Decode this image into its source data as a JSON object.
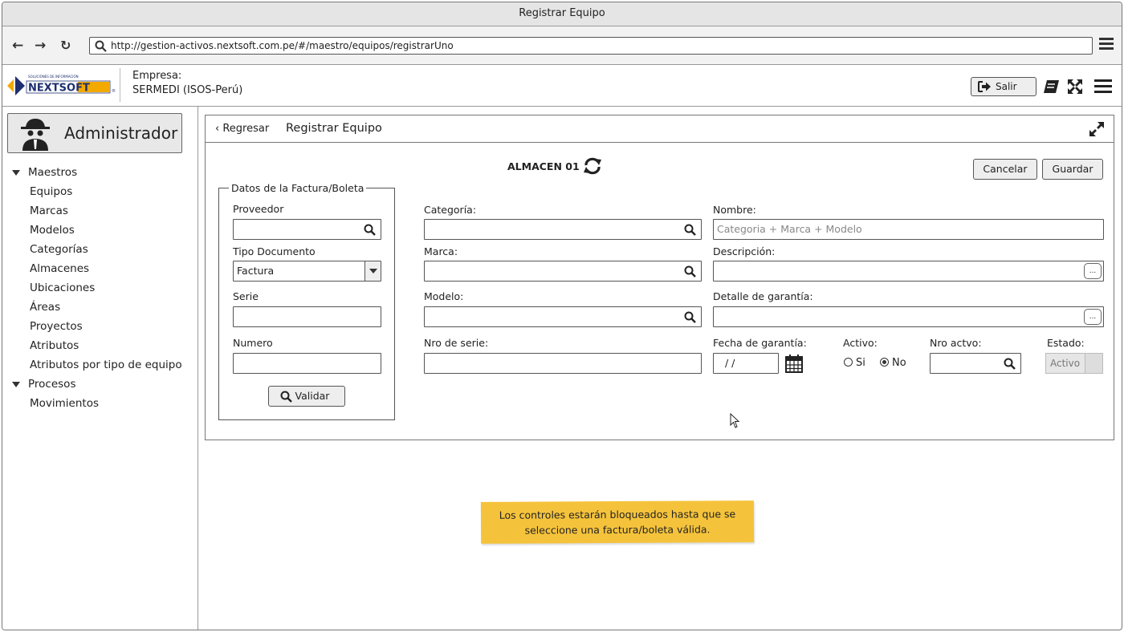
{
  "window": {
    "title": "Registrar Equipo"
  },
  "browser": {
    "url": "http://gestion-activos.nextsoft.com.pe/#/maestro/equipos/registrarUno"
  },
  "header": {
    "logo_text": "NEXTSOFT",
    "logo_tagline": "SOLUCIONES DE INFORMACIÓN",
    "empresa_label": "Empresa:",
    "empresa_value": "SERMEDI (ISOS-Perú)",
    "salir_label": "Salir"
  },
  "sidebar": {
    "user": "Administrador",
    "groups": [
      {
        "label": "Maestros",
        "items": [
          "Equipos",
          "Marcas",
          "Modelos",
          "Categorías",
          "Almacenes",
          "Ubicaciones",
          "Áreas",
          "Proyectos",
          "Atributos",
          "Atributos por tipo de equipo"
        ]
      },
      {
        "label": "Procesos",
        "items": [
          "Movimientos"
        ]
      }
    ]
  },
  "panel": {
    "back_label": "Regresar",
    "title": "Registrar Equipo",
    "almacen": "ALMACEN 01",
    "cancel_label": "Cancelar",
    "save_label": "Guardar",
    "factura": {
      "legend": "Datos de la Factura/Boleta",
      "proveedor_label": "Proveedor",
      "proveedor_value": "",
      "tipo_label": "Tipo Documento",
      "tipo_value": "Factura",
      "serie_label": "Serie",
      "serie_value": "",
      "numero_label": "Numero",
      "numero_value": "",
      "validar_label": "Validar"
    },
    "categoria_label": "Categoría:",
    "categoria_value": "",
    "marca_label": "Marca:",
    "marca_value": "",
    "modelo_label": "Modelo:",
    "modelo_value": "",
    "nro_serie_label": "Nro de serie:",
    "nro_serie_value": "",
    "nombre_label": "Nombre:",
    "nombre_placeholder": "Categoria + Marca + Modelo",
    "descripcion_label": "Descripción:",
    "descripcion_value": "",
    "garantia_label": "Detalle de garantía:",
    "garantia_value": "",
    "fecha_label": "Fecha de garantía:",
    "fecha_value": "/ /",
    "activo_label": "Activo:",
    "activo_options": [
      "Si",
      "No"
    ],
    "activo_selected": "No",
    "nro_activo_label": "Nro actvo:",
    "nro_activo_value": "",
    "estado_label": "Estado:",
    "estado_value": "Activo",
    "dots_label": "..."
  },
  "note": {
    "line1": "Los controles estarán bloqueados hasta que se",
    "line2": "seleccione una factura/boleta válida.",
    "color": "#f5c33b"
  }
}
